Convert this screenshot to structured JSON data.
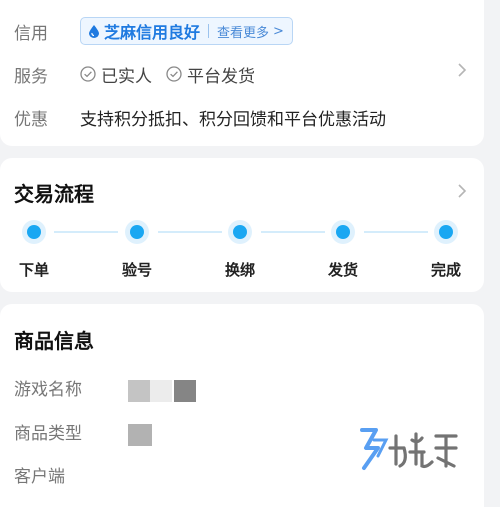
{
  "credit_row": {
    "label": "信用",
    "badge_text": "芝麻信用良好",
    "badge_more": "查看更多",
    "badge_chevron": ">"
  },
  "service_row": {
    "label": "服务",
    "tags": [
      "已实人",
      "平台发货"
    ]
  },
  "offer_row": {
    "label": "优惠",
    "text": "支持积分抵扣、积分回馈和平台优惠活动"
  },
  "trade_process": {
    "title": "交易流程",
    "steps": [
      "下单",
      "验号",
      "换绑",
      "发货",
      "完成"
    ]
  },
  "product_info": {
    "title": "商品信息",
    "fields": [
      "游戏名称",
      "商品类型",
      "客户端"
    ]
  },
  "colors": {
    "accent_blue": "#1aa7f2",
    "credit_blue": "#1f7ae0",
    "watermark_blue": "#3d8ff0"
  }
}
